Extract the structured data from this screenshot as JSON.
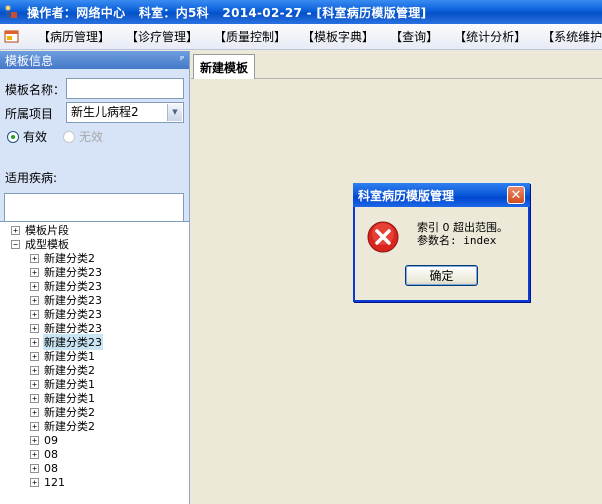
{
  "window": {
    "title": "操作者：网络中心   科室：内5科   2014-02-27 - [科室病历模版管理]"
  },
  "menu": {
    "items": [
      "【病历管理】",
      "【诊疗管理】",
      "【质量控制】",
      "【模板字典】",
      "【查询】",
      "【统计分析】",
      "【系统维护】"
    ]
  },
  "left_panel": {
    "title": "模板信息",
    "pin_glyph": "ᴾ",
    "form": {
      "name_label": "模板名称：",
      "name_value": "",
      "project_label": "所属项目",
      "project_value": "新生儿病程2",
      "radio_valid": "有效",
      "radio_invalid": "无效",
      "disease_label": "适用疾病:"
    },
    "tree": {
      "nodes": [
        {
          "label": "模板片段",
          "level": 0,
          "expander": "+",
          "selected": false
        },
        {
          "label": "成型模板",
          "level": 0,
          "expander": "−",
          "selected": false
        },
        {
          "label": "新建分类2",
          "level": 1,
          "expander": "+",
          "selected": false
        },
        {
          "label": "新建分类23",
          "level": 1,
          "expander": "+",
          "selected": false
        },
        {
          "label": "新建分类23",
          "level": 1,
          "expander": "+",
          "selected": false
        },
        {
          "label": "新建分类23",
          "level": 1,
          "expander": "+",
          "selected": false
        },
        {
          "label": "新建分类23",
          "level": 1,
          "expander": "+",
          "selected": false
        },
        {
          "label": "新建分类23",
          "level": 1,
          "expander": "+",
          "selected": false
        },
        {
          "label": "新建分类23",
          "level": 1,
          "expander": "+",
          "selected": true
        },
        {
          "label": "新建分类1",
          "level": 1,
          "expander": "+",
          "selected": false
        },
        {
          "label": "新建分类2",
          "level": 1,
          "expander": "+",
          "selected": false
        },
        {
          "label": "新建分类1",
          "level": 1,
          "expander": "+",
          "selected": false
        },
        {
          "label": "新建分类1",
          "level": 1,
          "expander": "+",
          "selected": false
        },
        {
          "label": "新建分类2",
          "level": 1,
          "expander": "+",
          "selected": false
        },
        {
          "label": "新建分类2",
          "level": 1,
          "expander": "+",
          "selected": false
        },
        {
          "label": "09",
          "level": 1,
          "expander": "+",
          "selected": false
        },
        {
          "label": "08",
          "level": 1,
          "expander": "+",
          "selected": false
        },
        {
          "label": "08",
          "level": 1,
          "expander": "+",
          "selected": false
        },
        {
          "label": "121",
          "level": 1,
          "expander": "+",
          "selected": false
        }
      ]
    }
  },
  "tabs": [
    {
      "label": "新建模板",
      "active": true
    }
  ],
  "dialog": {
    "title": "科室病历模版管理",
    "close_glyph": "✕",
    "line1": "索引 0 超出范围。",
    "line2": "参数名: index",
    "ok_label": "确定"
  }
}
